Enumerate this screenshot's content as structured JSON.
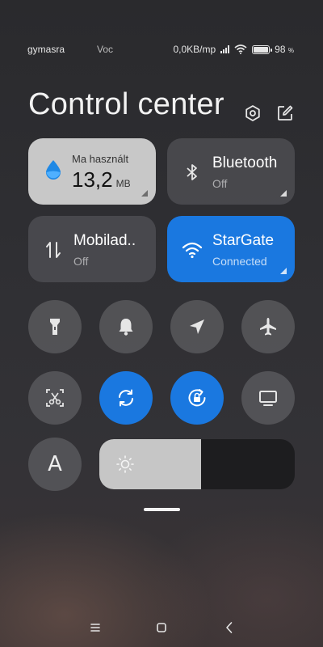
{
  "status_bar": {
    "left_text": "gymasra",
    "left_text2": "Voc",
    "network_speed": "0,0KB/mp",
    "battery_percent": "98",
    "battery_percent_suffix": "%",
    "battery_level": 0.98
  },
  "title": "Control center",
  "header_icons": [
    "settings-icon",
    "edit-icon"
  ],
  "tiles": {
    "data_usage": {
      "label": "Ma használt",
      "value": "13,2",
      "unit": "MB",
      "icon": "water-drop-icon"
    },
    "bluetooth": {
      "label": "Bluetooth",
      "status": "Off",
      "icon": "bluetooth-icon"
    },
    "mobile_data": {
      "label": "Mobilad..",
      "status": "Off",
      "icon": "mobile-data-icon"
    },
    "wifi": {
      "label": "StarGate",
      "status": "Connected",
      "icon": "wifi-icon",
      "color": "#1a78e0"
    }
  },
  "toggles_row1": [
    {
      "name": "flashlight",
      "icon": "flashlight-icon",
      "active": false
    },
    {
      "name": "silent",
      "icon": "bell-icon",
      "active": false
    },
    {
      "name": "location",
      "icon": "location-arrow-icon",
      "active": false
    },
    {
      "name": "airplane",
      "icon": "airplane-icon",
      "active": false
    }
  ],
  "toggles_row2": [
    {
      "name": "screenshot",
      "icon": "scissors-icon",
      "active": false
    },
    {
      "name": "auto-rotate",
      "icon": "sync-icon",
      "active": true
    },
    {
      "name": "rotation-lock",
      "icon": "rotation-lock-icon",
      "active": true
    },
    {
      "name": "cast",
      "icon": "monitor-icon",
      "active": false
    }
  ],
  "font_button": {
    "label": "A"
  },
  "brightness": {
    "level": 0.52,
    "icon": "sun-icon"
  },
  "nav_bar": [
    "menu-icon",
    "home-icon",
    "back-icon"
  ],
  "colors": {
    "accent": "#1a78e0",
    "tile_dark": "#505054",
    "tile_light": "#c8c8c8"
  }
}
